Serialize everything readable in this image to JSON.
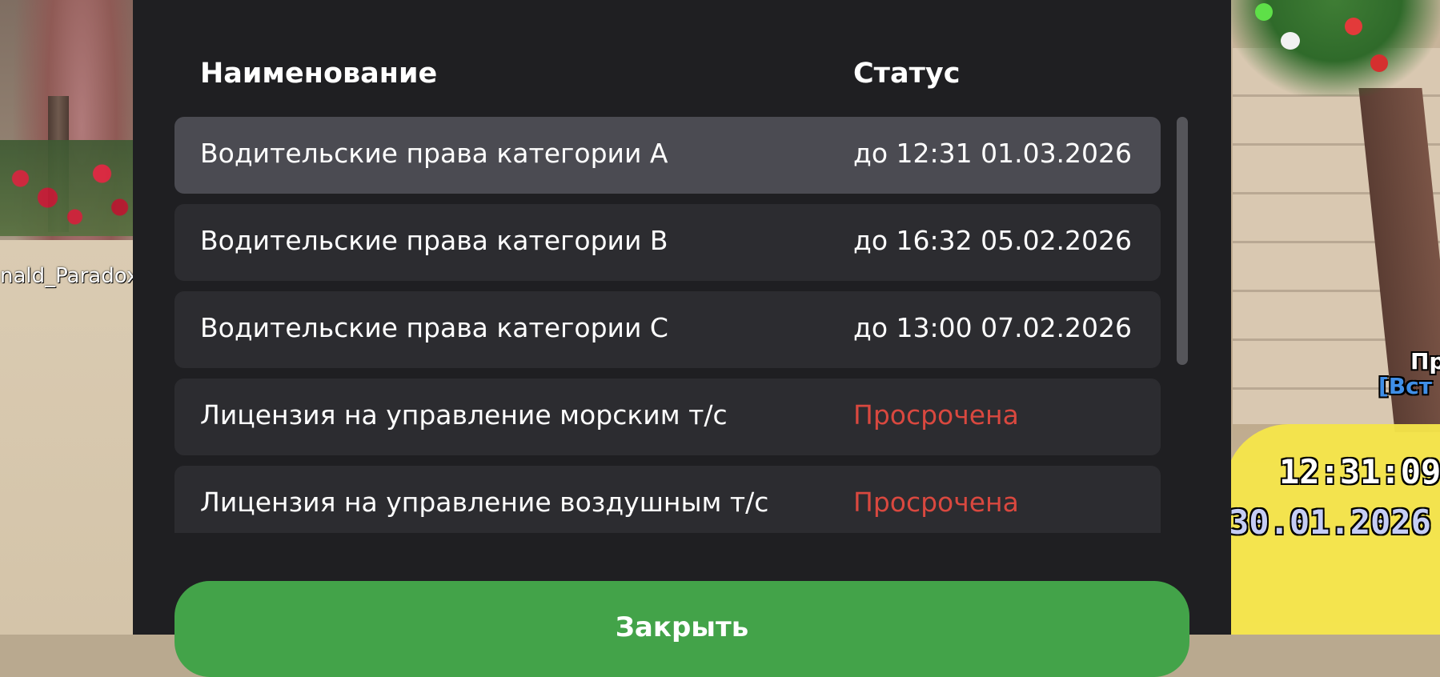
{
  "world": {
    "player_name": "nald_Paradox",
    "hud": {
      "time": "12:31:09",
      "date": "30.01.2026",
      "label_partial": "Пр",
      "tag_partial": "[Вст"
    }
  },
  "table": {
    "headers": {
      "name": "Наименование",
      "status": "Статус"
    },
    "rows": [
      {
        "name": "Водительские права категории A",
        "status": "до 12:31 01.03.2026",
        "expired": false,
        "selected": true
      },
      {
        "name": "Водительские права категории B",
        "status": "до 16:32 05.02.2026",
        "expired": false,
        "selected": false
      },
      {
        "name": "Водительские права категории C",
        "status": "до 13:00 07.02.2026",
        "expired": false,
        "selected": false
      },
      {
        "name": "Лицензия на управление морским т/с",
        "status": "Просрочена",
        "expired": true,
        "selected": false
      },
      {
        "name": "Лицензия на управление воздушным т/с",
        "status": "Просрочена",
        "expired": true,
        "selected": false
      }
    ]
  },
  "buttons": {
    "close_label": "Закрыть"
  },
  "colors": {
    "panel_bg": "#1f1f22",
    "row_bg": "#2c2c30",
    "row_selected_bg": "#4b4b52",
    "expired_text": "#d9483f",
    "close_button": "#43a349"
  }
}
